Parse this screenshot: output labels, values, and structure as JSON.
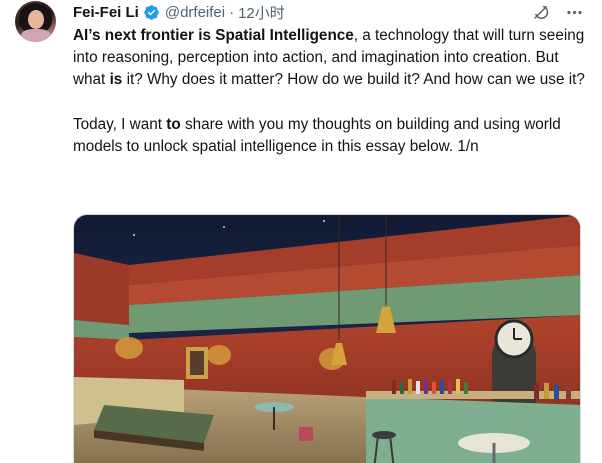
{
  "author": {
    "name": "Fei-Fei Li",
    "handle": "@drfeifei",
    "time": "12小时",
    "separator": "·"
  },
  "tweet": {
    "p1_bold1": "AI’s next frontier is Spatial Intelligence",
    "p1_text1": ", a technology that will turn seeing into reasoning, perception into action, and imagination into creation. But what ",
    "p1_bold2": "is",
    "p1_text2": " it? Why does it matter? How do we build it? And how can we use it?",
    "p2_text1": "Today, I want ",
    "p2_bold1": "to",
    "p2_text2": " share with you my thoughts on building and using world models to unlock spatial intelligence in this essay below. 1/n"
  },
  "icons": {
    "verified": "verified-badge-icon",
    "grok": "grok-icon",
    "more": "more-options-icon"
  },
  "colors": {
    "text": "#0f1419",
    "secondary": "#536471",
    "verified": "#1d9bf0",
    "border": "#cfd9de"
  }
}
